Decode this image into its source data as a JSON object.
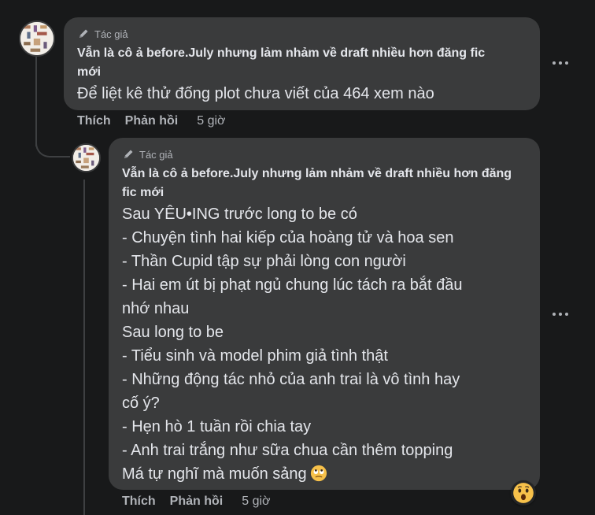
{
  "comment_1": {
    "author_badge": "Tác giả",
    "author_name": "Vẫn là cô ả before.July nhưng lảm nhảm về draft nhiều hơn đăng fic mới",
    "text": "Để liệt kê thử đống plot chưa viết của 464 xem nào",
    "actions": {
      "like": "Thích",
      "reply": "Phản hồi",
      "time": "5 giờ"
    }
  },
  "comment_2": {
    "author_badge": "Tác giả",
    "author_name": "Vẫn là cô ả before.July nhưng lảm nhảm về draft nhiều hơn đăng fic mới",
    "lines": [
      "Sau YÊU•ING trước long to be có",
      "- Chuyện tình hai kiếp của hoàng tử và hoa sen",
      "- Thần Cupid tập sự phải lòng con người",
      "- Hai em út bị phạt ngủ chung lúc tách ra bắt đầu",
      "nhớ nhau",
      "Sau long to be",
      "- Tiểu sinh và model phim giả tình thật",
      "- Những động tác nhỏ của anh trai là vô tình hay",
      "cố ý?",
      "- Hẹn hò 1 tuần rồi chia tay",
      "- Anh trai trắng như sữa chua cần thêm topping",
      "Má tự nghĩ mà muốn sảng"
    ],
    "actions": {
      "like": "Thích",
      "reply": "Phản hồi",
      "time": "5 giờ"
    },
    "reaction_icon": "wow-emoji"
  },
  "colors": {
    "background": "#18191a",
    "bubble": "#3a3b3c",
    "text_primary": "#e4e6eb",
    "text_secondary": "#b0b3b8"
  }
}
